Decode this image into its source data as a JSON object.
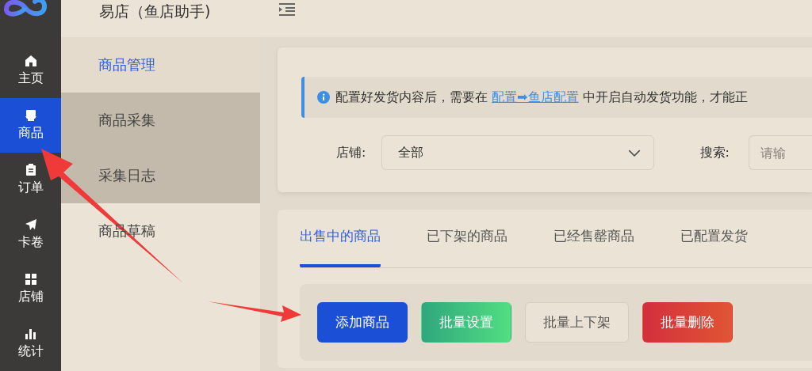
{
  "app": {
    "title": "易店（鱼店助手)"
  },
  "nav": [
    {
      "label": "主页",
      "kind": "home",
      "selected": false
    },
    {
      "label": "商品",
      "kind": "goods",
      "selected": true
    },
    {
      "label": "订单",
      "kind": "order",
      "selected": false
    },
    {
      "label": "卡卷",
      "kind": "send",
      "selected": false
    },
    {
      "label": "店铺",
      "kind": "grid",
      "selected": false
    },
    {
      "label": "统计",
      "kind": "chart",
      "selected": false
    }
  ],
  "submenu": [
    {
      "label": "商品管理",
      "selected": true,
      "highlighted": false
    },
    {
      "label": "商品采集",
      "selected": false,
      "highlighted": true
    },
    {
      "label": "采集日志",
      "selected": false,
      "highlighted": true
    },
    {
      "label": "商品草稿",
      "selected": false,
      "highlighted": false
    }
  ],
  "alert": {
    "before": "配置好发货内容后，需要在",
    "link": "配置➡鱼店配置",
    "after": "中开启自动发货功能，才能正"
  },
  "filters": {
    "shop_label": "店铺:",
    "shop_value": "全部",
    "search_label": "搜索:",
    "search_placeholder": "请输"
  },
  "tabs": [
    {
      "label": "出售中的商品",
      "selected": true
    },
    {
      "label": "已下架的商品",
      "selected": false
    },
    {
      "label": "已经售罄商品",
      "selected": false
    },
    {
      "label": "已配置发货",
      "selected": false
    }
  ],
  "buttons": [
    {
      "label": "添加商品",
      "kind": "primary"
    },
    {
      "label": "批量设置",
      "kind": "success"
    },
    {
      "label": "批量上下架",
      "kind": "plain"
    },
    {
      "label": "批量删除",
      "kind": "danger"
    }
  ]
}
